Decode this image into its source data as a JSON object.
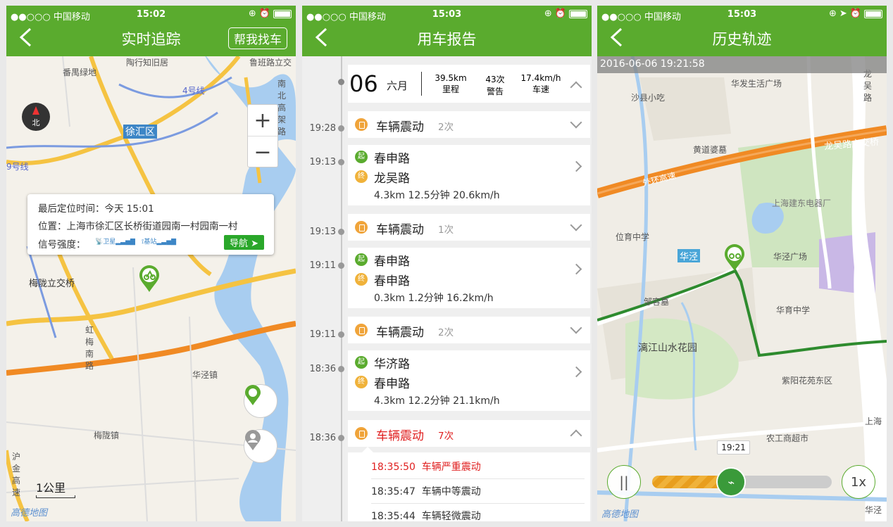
{
  "status": {
    "carrier": "●●○○○ 中国移动",
    "times": [
      "15:02",
      "15:03",
      "15:03"
    ]
  },
  "screen1": {
    "title": "实时追踪",
    "help_button": "帮我找车",
    "map_labels": [
      "番禺绿地",
      "陶行知旧居",
      "鲁班路立交",
      "徐汇区",
      "4号线",
      "9号线",
      "梅陇立交桥",
      "华泾镇",
      "梅陇镇",
      "南北高架路",
      "虹梅南路",
      "沪金高速"
    ],
    "compass": "北",
    "popup": {
      "time_label": "最后定位时间：今天 15:01",
      "location_label": "位置：上海市徐汇区长桥街道园南一村园南一村",
      "signal_label": "信号强度：",
      "satellite": "卫星",
      "base_station": "基站",
      "nav_button": "导航"
    },
    "scale": "1公里",
    "logo": "高德地图"
  },
  "screen2": {
    "title": "用车报告",
    "summary": {
      "day": "06",
      "month": "六月",
      "distance": "39.5km",
      "distance_label": "里程",
      "alerts": "43次",
      "alerts_label": "警告",
      "speed": "17.4km/h",
      "speed_label": "车速"
    },
    "rows": [
      {
        "time": "19:28",
        "type": "vib",
        "label": "车辆震动",
        "count": "2次"
      },
      {
        "time": "19:13",
        "type": "trip",
        "from_badge": "起",
        "from": "春申路",
        "to_badge": "终",
        "to": "龙吴路",
        "stats": "4.3km 12.5分钟 20.6km/h"
      },
      {
        "time": "19:13",
        "type": "vib",
        "label": "车辆震动",
        "count": "1次"
      },
      {
        "time": "19:11",
        "type": "trip",
        "from_badge": "起",
        "from": "春申路",
        "to_badge": "终",
        "to": "春申路",
        "stats": "0.3km 1.2分钟 16.2km/h"
      },
      {
        "time": "19:11",
        "type": "vib",
        "label": "车辆震动",
        "count": "2次"
      },
      {
        "time": "18:36",
        "type": "trip",
        "from_badge": "起",
        "from": "华济路",
        "to_badge": "终",
        "to": "春申路",
        "stats": "4.3km 12.2分钟 21.1km/h"
      },
      {
        "time": "18:36",
        "type": "vib-open",
        "label": "车辆震动",
        "count": "7次"
      }
    ],
    "details": [
      {
        "time": "18:35:50",
        "label": "车辆严重震动"
      },
      {
        "time": "18:35:47",
        "label": "车辆中等震动"
      },
      {
        "time": "18:35:44",
        "label": "车辆轻微震动"
      }
    ]
  },
  "screen3": {
    "title": "历史轨迹",
    "timestamp": "2016-06-06 19:21:58",
    "map_labels": [
      "沙县小吃",
      "华发生活广场",
      "龙吴路",
      "黄道婆墓",
      "外环高速",
      "龙吴路立交桥",
      "上海建东电器厂",
      "位育中学",
      "华泾",
      "华泾广场",
      "邹容墓",
      "华育中学",
      "漓江山水花园",
      "紫阳花苑东区",
      "上海",
      "农工商超市",
      "华泾"
    ],
    "tooltip": "19:21",
    "speed": "1x",
    "logo": "高德地图",
    "progress": 0.44
  },
  "colors": {
    "header": "#5aab2e",
    "route": "#2e8b2e",
    "highway": "#f08a24",
    "alert": "#e02020"
  }
}
